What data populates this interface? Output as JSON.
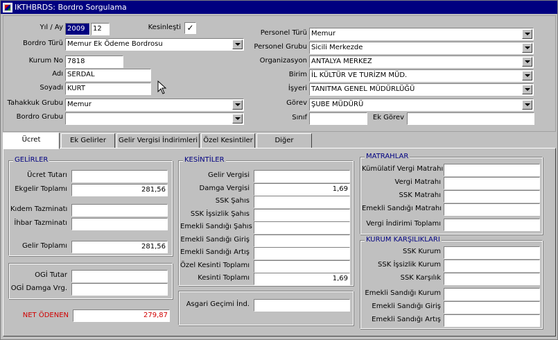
{
  "window": {
    "title": "IKTHBRDS: Bordro Sorgulama",
    "icon": "app-icon"
  },
  "form": {
    "yil_ay": {
      "label": "Yıl / Ay",
      "year": "2009",
      "month": "12"
    },
    "kesinlesti": {
      "label": "Kesinleşti",
      "checked": "✓"
    },
    "bordro_turu": {
      "label": "Bordro Türü",
      "value": "Memur Ek Ödeme Bordrosu"
    },
    "kurum_no": {
      "label": "Kurum No",
      "value": "7818"
    },
    "adi": {
      "label": "Adı",
      "value": "SERDAL"
    },
    "soyadi": {
      "label": "Soyadı",
      "value": "KURT"
    },
    "tahakkuk_grubu": {
      "label": "Tahakkuk Grubu",
      "value": "Memur"
    },
    "bordro_grubu": {
      "label": "Bordro Grubu",
      "value": ""
    },
    "personel_turu": {
      "label": "Personel Türü",
      "value": "Memur"
    },
    "personel_grubu": {
      "label": "Personel Grubu",
      "value": "Sicili Merkezde"
    },
    "organizasyon": {
      "label": "Organizasyon",
      "value": "ANTALYA MERKEZ"
    },
    "birim": {
      "label": "Birim",
      "value": "İL KÜLTÜR VE TURİZM MÜD."
    },
    "isyeri": {
      "label": "İşyeri",
      "value": "TANITMA GENEL MÜDÜRLÜĞÜ"
    },
    "gorev": {
      "label": "Görev",
      "value": "ŞUBE MÜDÜRÜ"
    },
    "sinif": {
      "label": "Sınıf",
      "value": ""
    },
    "ek_gorev": {
      "label": "Ek Görev",
      "value": ""
    }
  },
  "tabs": [
    {
      "label": "Ücret",
      "active": true
    },
    {
      "label": "Ek Gelirler"
    },
    {
      "label": "Gelir Vergisi İndirimleri"
    },
    {
      "label": "Özel Kesintiler"
    },
    {
      "label": "Diğer"
    }
  ],
  "gelirler": {
    "title": "GELİRLER",
    "ucret_tutari": {
      "label": "Ücret Tutarı",
      "value": ""
    },
    "ekgelir_toplami": {
      "label": "Ekgelir Toplamı",
      "value": "281,56"
    },
    "kidem_tazminati": {
      "label": "Kıdem Tazminatı",
      "value": ""
    },
    "ihbar_tazminati": {
      "label": "İhbar Tazminatı",
      "value": ""
    },
    "gelir_toplami": {
      "label": "Gelir Toplamı",
      "value": "281,56"
    }
  },
  "ogi": {
    "ogi_tutar": {
      "label": "OGİ Tutar",
      "value": ""
    },
    "ogi_damga": {
      "label": "OGİ Damga Vrg.",
      "value": ""
    }
  },
  "net_odenen": {
    "label": "NET ÖDENEN",
    "value": "279,87"
  },
  "kesintiler": {
    "title": "KESİNTİLER",
    "items": [
      {
        "label": "Gelir Vergisi",
        "value": ""
      },
      {
        "label": "Damga Vergisi",
        "value": "1,69"
      },
      {
        "label": "SSK Şahıs",
        "value": ""
      },
      {
        "label": "SSK İşsizlik Şahıs",
        "value": ""
      },
      {
        "label": "Emekli Sandığı Şahıs",
        "value": ""
      },
      {
        "label": "Emekli Sandığı Giriş",
        "value": ""
      },
      {
        "label": "Emekli Sandığı Artış",
        "value": ""
      },
      {
        "label": "Özel Kesinti Toplamı",
        "value": ""
      },
      {
        "label": "Kesinti Toplamı",
        "value": "1,69"
      }
    ]
  },
  "asgari": {
    "label": "Asgari Geçimi İnd.",
    "value": ""
  },
  "matrahlar": {
    "title": "MATRAHLAR",
    "items": [
      {
        "label": "Kümülatif Vergi Matrahı",
        "value": ""
      },
      {
        "label": "Vergi Matrahı",
        "value": ""
      },
      {
        "label": "SSK Matrahı",
        "value": ""
      },
      {
        "label": "Emekli Sandığı Matrahı",
        "value": ""
      },
      {
        "label": "Vergi İndirimi Toplamı",
        "value": ""
      }
    ]
  },
  "kurum": {
    "title": "KURUM KARŞILIKLARI",
    "items": [
      {
        "label": "SSK Kurum",
        "value": ""
      },
      {
        "label": "SSK İşsizlik Kurum",
        "value": ""
      },
      {
        "label": "SSK Karşılık",
        "value": ""
      },
      {
        "label": "Emekli Sandığı Kurum",
        "value": ""
      },
      {
        "label": "Emekli Sandığı Giriş",
        "value": ""
      },
      {
        "label": "Emekli Sandığı Artış",
        "value": ""
      }
    ]
  },
  "colors": {
    "title_bar": "#000080",
    "window_bg": "#c0c0c0",
    "group_title": "#000080",
    "net_text": "#d00000"
  }
}
